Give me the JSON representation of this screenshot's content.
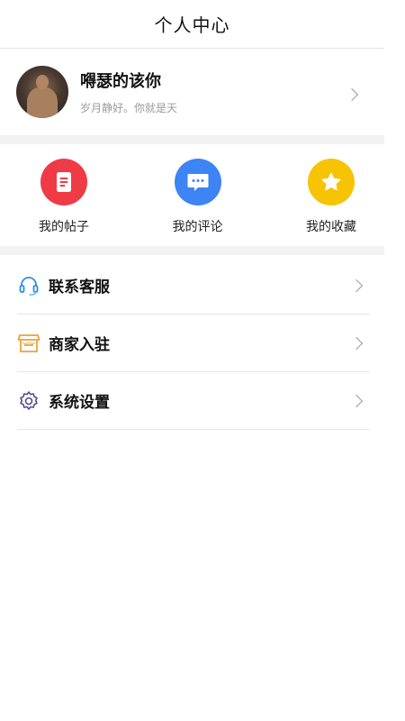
{
  "header": {
    "title": "个人中心"
  },
  "profile": {
    "name": "嘚瑟的该你",
    "bio": "岁月静好。你就是天"
  },
  "quick_actions": [
    {
      "label": "我的帖子",
      "icon": "document-icon",
      "color": "#ef3b46"
    },
    {
      "label": "我的评论",
      "icon": "comment-icon",
      "color": "#3d84f4"
    },
    {
      "label": "我的收藏",
      "icon": "star-icon",
      "color": "#f7c404"
    }
  ],
  "menu": [
    {
      "label": "联系客服",
      "icon": "headset-icon"
    },
    {
      "label": "商家入驻",
      "icon": "store-icon"
    },
    {
      "label": "系统设置",
      "icon": "gear-icon"
    }
  ]
}
